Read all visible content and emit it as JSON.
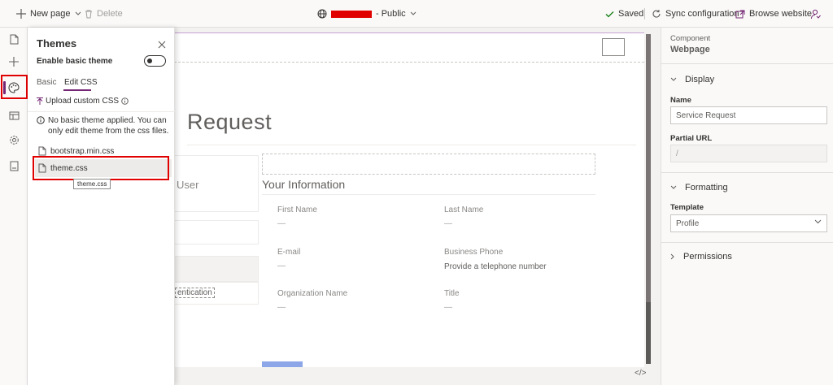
{
  "topbar": {
    "new_page": "New page",
    "delete": "Delete",
    "site_visibility": "- Public",
    "saved": "Saved",
    "sync": "Sync configuration",
    "browse": "Browse website"
  },
  "rail": {
    "items": [
      "pages-icon",
      "add-icon",
      "themes-icon",
      "templates-icon",
      "settings-icon",
      "data-icon"
    ]
  },
  "themes_panel": {
    "title": "Themes",
    "enable_label": "Enable basic theme",
    "enabled": false,
    "tabs": [
      "Basic",
      "Edit CSS"
    ],
    "active_tab": "Edit CSS",
    "upload_label": "Upload custom CSS",
    "info_text": "No basic theme applied. You can only edit theme from the css files.",
    "files": [
      "bootstrap.min.css",
      "theme.css"
    ],
    "selected_file": "theme.css",
    "tooltip": "theme.css"
  },
  "preview": {
    "title": "Request",
    "card_text_1": "User",
    "card_text_2": "entication",
    "section_title": "Your Information",
    "fields": [
      {
        "label": "First Name",
        "value": "—"
      },
      {
        "label": "Last Name",
        "value": "—"
      },
      {
        "label": "E-mail",
        "value": "—"
      },
      {
        "label": "Business Phone",
        "value": "Provide a telephone number"
      },
      {
        "label": "Organization Name",
        "value": "—"
      },
      {
        "label": "Title",
        "value": "—"
      }
    ],
    "code_toggle": "</>"
  },
  "properties": {
    "component_label": "Component",
    "component_value": "Webpage",
    "display_section": "Display",
    "name_label": "Name",
    "name_value": "Service Request",
    "partial_url_label": "Partial URL",
    "partial_url_value": "/",
    "formatting_section": "Formatting",
    "template_label": "Template",
    "template_value": "Profile",
    "permissions_section": "Permissions"
  },
  "colors": {
    "accent": "#742774",
    "highlight": "#e00000",
    "submit": "#8ca6e8"
  }
}
